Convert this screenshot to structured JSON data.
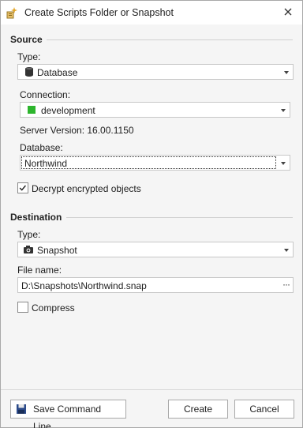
{
  "window": {
    "title": "Create Scripts Folder or Snapshot",
    "app_icon": "wizard-icon",
    "close_icon": "close-icon"
  },
  "source": {
    "header": "Source",
    "type_label": "Type:",
    "type_value": "Database",
    "type_icon": "database-icon",
    "connection_label": "Connection:",
    "connection_value": "development",
    "connection_color": "#2db52d",
    "server_version": "Server Version: 16.00.1150",
    "database_label": "Database:",
    "database_value": "Northwind",
    "decrypt_label": "Decrypt encrypted objects",
    "decrypt_checked": true
  },
  "destination": {
    "header": "Destination",
    "type_label": "Type:",
    "type_value": "Snapshot",
    "type_icon": "camera-icon",
    "file_label": "File name:",
    "file_value": "D:\\Snapshots\\Northwind.snap",
    "browse_label": "···",
    "compress_label": "Compress",
    "compress_checked": false
  },
  "buttons": {
    "save_cmd": "Save Command Line...",
    "save_icon": "floppy-disk-icon",
    "create": "Create",
    "cancel": "Cancel"
  }
}
